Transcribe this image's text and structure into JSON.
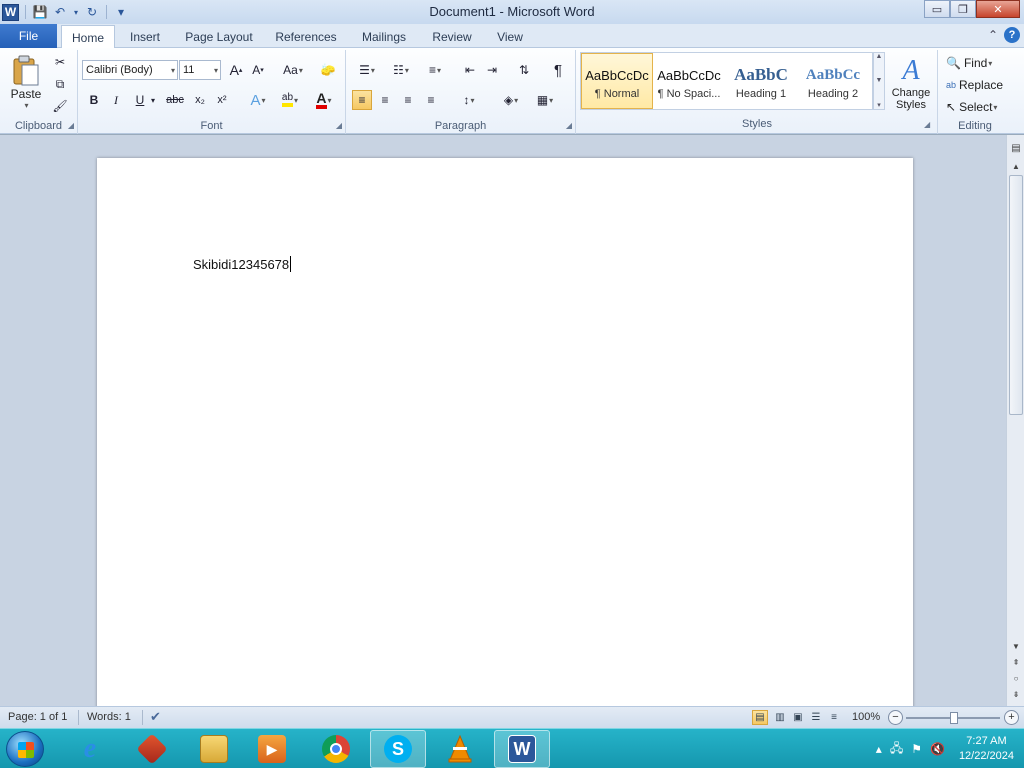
{
  "window": {
    "title": "Document1 - Microsoft Word",
    "app_logo": "W",
    "controls": {
      "minimize": "▭",
      "maximize": "❐",
      "close": "✕"
    }
  },
  "qat": {
    "save_icon": "💾",
    "undo_icon": "↶",
    "redo_icon": "↻",
    "customize_icon": "▾"
  },
  "tabs": {
    "file": "File",
    "home": "Home",
    "insert": "Insert",
    "page_layout": "Page Layout",
    "references": "References",
    "mailings": "Mailings",
    "review": "Review",
    "view": "View",
    "minimize_ribbon_icon": "⌃",
    "help_icon": "?"
  },
  "clipboard": {
    "label": "Clipboard",
    "paste_label": "Paste",
    "paste_arrow": "▾",
    "cut_icon": "✂",
    "copy_icon": "⧉",
    "format_painter_icon": "🖌"
  },
  "font": {
    "label": "Font",
    "family_value": "Calibri (Body)",
    "size_value": "11",
    "grow_font": "A",
    "shrink_font": "A",
    "change_case": "Aa",
    "clear_format_icon": "🧽",
    "bold": "B",
    "italic": "I",
    "underline": "U",
    "strikethrough": "abc",
    "subscript": "x₂",
    "superscript": "x²",
    "text_effects": "A",
    "highlight": "ab",
    "font_color": "A"
  },
  "paragraph": {
    "label": "Paragraph",
    "bullets_icon": "☰",
    "numbering_icon": "☷",
    "multilevel_icon": "≡",
    "decrease_indent_icon": "⇤",
    "increase_indent_icon": "⇥",
    "sort_icon": "⇅",
    "show_marks_icon": "¶",
    "align_left_icon": "≡",
    "center_icon": "≡",
    "align_right_icon": "≡",
    "justify_icon": "≡",
    "line_spacing_icon": "↕",
    "shading_icon": "◈",
    "borders_icon": "▦"
  },
  "styles": {
    "label": "Styles",
    "items": [
      {
        "preview": "AaBbCcDc",
        "name": "¶ Normal"
      },
      {
        "preview": "AaBbCcDc",
        "name": "¶ No Spaci..."
      },
      {
        "preview": "AaBbC",
        "name": "Heading 1"
      },
      {
        "preview": "AaBbCc",
        "name": "Heading 2"
      }
    ],
    "change_styles": "Change Styles",
    "change_styles_icon": "A"
  },
  "editing": {
    "label": "Editing",
    "find": "Find",
    "replace": "Replace",
    "select": "Select"
  },
  "document": {
    "text": "Skibidi12345678"
  },
  "statusbar": {
    "page": "Page: 1 of 1",
    "words": "Words: 1",
    "zoom": "100%",
    "zoom_minus": "−",
    "zoom_plus": "+",
    "zoom_level_percent": 100
  },
  "taskbar": {
    "time": "7:27 AM",
    "date": "12/22/2024",
    "apps": [
      "internet-explorer",
      "app-red",
      "file-explorer",
      "media-player",
      "chrome",
      "skype",
      "vlc",
      "microsoft-word"
    ]
  },
  "colors": {
    "accent": "#2b579a",
    "file_tab": "#2560b8",
    "taskbar": "#1597ae",
    "selected_style": "#ffe9a5"
  }
}
